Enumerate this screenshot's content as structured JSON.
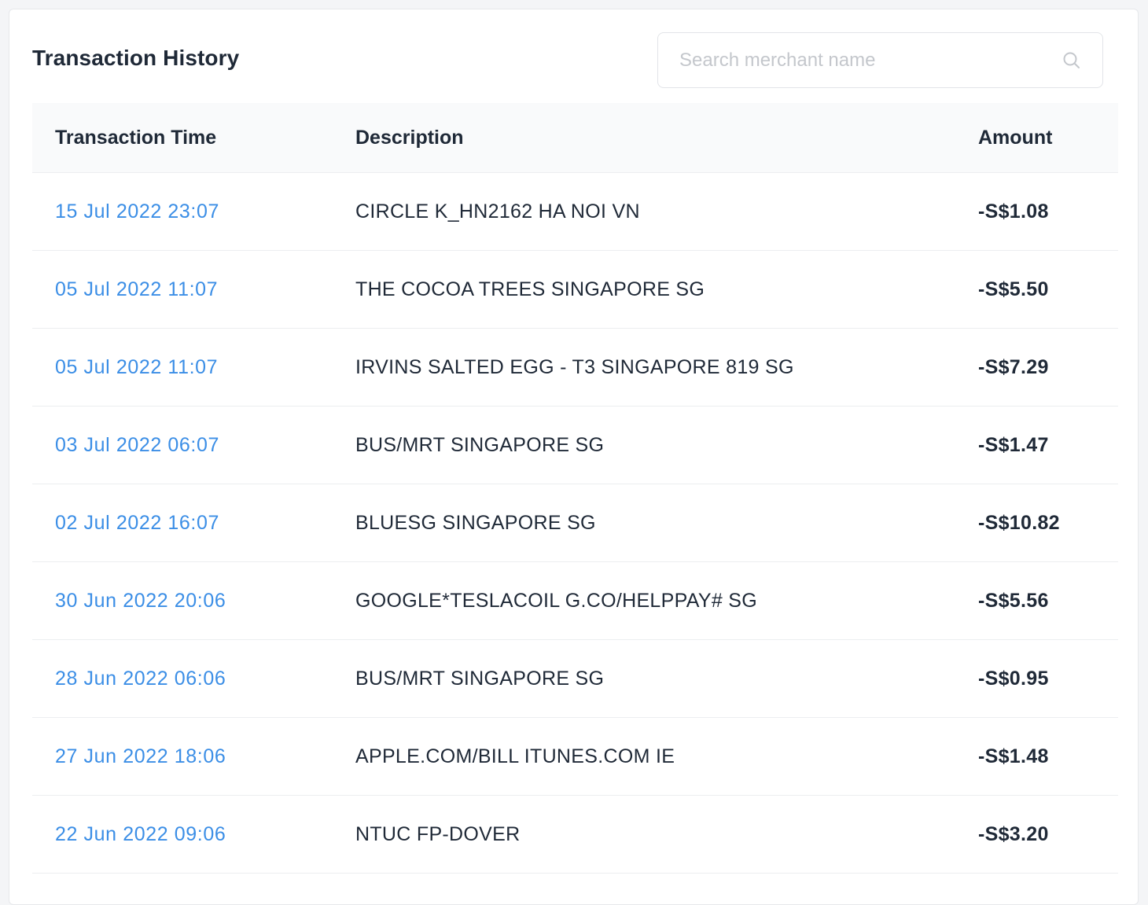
{
  "header": {
    "title": "Transaction History"
  },
  "search": {
    "placeholder": "Search merchant name",
    "value": "",
    "icon": "search-icon"
  },
  "table": {
    "columns": [
      "Transaction Time",
      "Description",
      "Amount"
    ],
    "rows": [
      {
        "time": "15 Jul 2022 23:07",
        "description": "CIRCLE K_HN2162 HA NOI VN",
        "amount": "-S$1.08"
      },
      {
        "time": "05 Jul 2022 11:07",
        "description": "THE COCOA TREES SINGAPORE SG",
        "amount": "-S$5.50"
      },
      {
        "time": "05 Jul 2022 11:07",
        "description": "IRVINS SALTED EGG - T3 SINGAPORE 819 SG",
        "amount": "-S$7.29"
      },
      {
        "time": "03 Jul 2022 06:07",
        "description": "BUS/MRT SINGAPORE SG",
        "amount": "-S$1.47"
      },
      {
        "time": "02 Jul 2022 16:07",
        "description": "BLUESG SINGAPORE SG",
        "amount": "-S$10.82"
      },
      {
        "time": "30 Jun 2022 20:06",
        "description": "GOOGLE*TESLACOIL G.CO/HELPPAY# SG",
        "amount": "-S$5.56"
      },
      {
        "time": "28 Jun 2022 06:06",
        "description": "BUS/MRT SINGAPORE SG",
        "amount": "-S$0.95"
      },
      {
        "time": "27 Jun 2022 18:06",
        "description": "APPLE.COM/BILL ITUNES.COM IE",
        "amount": "-S$1.48"
      },
      {
        "time": "22 Jun 2022 09:06",
        "description": "NTUC FP-DOVER",
        "amount": "-S$3.20"
      }
    ]
  },
  "colors": {
    "link": "#3b8ee6",
    "text": "#1f2937",
    "header_bg": "#f9fafb",
    "page_bg": "#f4f5f7"
  }
}
